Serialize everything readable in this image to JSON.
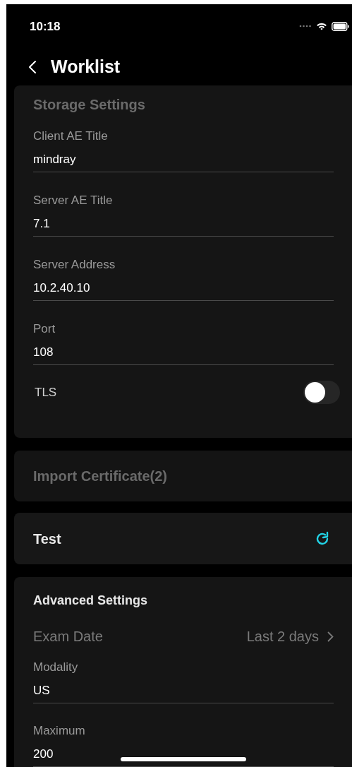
{
  "status_bar": {
    "time": "10:18"
  },
  "nav": {
    "title": "Worklist"
  },
  "storage": {
    "title": "Storage Settings",
    "disabled": true,
    "fields": [
      {
        "label": "Client AE Title",
        "value": "mindray"
      },
      {
        "label": "Server AE Title",
        "value": "7.1"
      },
      {
        "label": "Server Address",
        "value": "10.2.40.10"
      },
      {
        "label": "Port",
        "value": "108"
      }
    ],
    "tls": {
      "label": "TLS",
      "on": false
    }
  },
  "import_certificate": {
    "label": "Import Certificate(2)",
    "disabled": true
  },
  "test": {
    "label": "Test",
    "disabled": false
  },
  "advanced": {
    "title": "Advanced Settings",
    "disabled": false,
    "exam_date": {
      "label": "Exam Date",
      "value": "Last 2 days",
      "disabled": true
    },
    "fields": [
      {
        "label": "Modality",
        "value": "US"
      },
      {
        "label": "Maximum",
        "value": "200"
      }
    ]
  }
}
